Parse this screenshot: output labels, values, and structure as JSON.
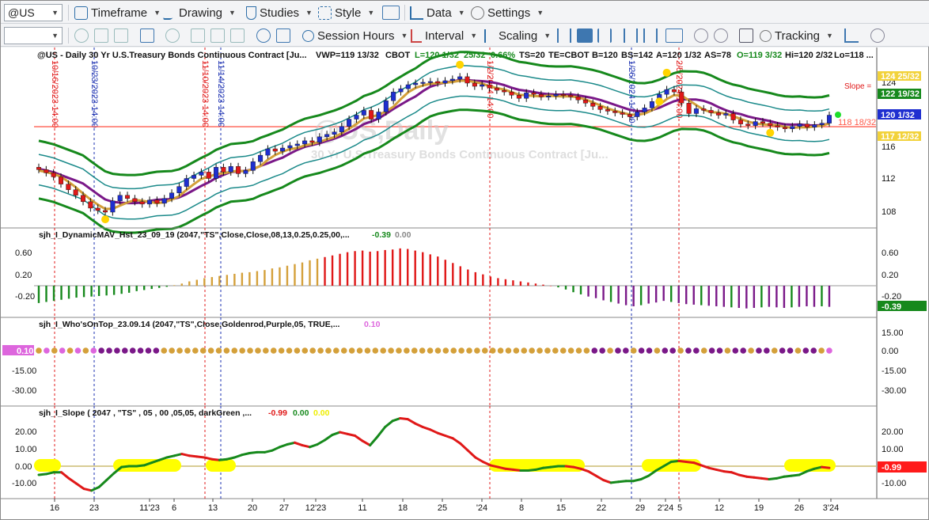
{
  "toolbar1": {
    "symbol": "@US",
    "timeframe": "Timeframe",
    "drawing": "Drawing",
    "studies": "Studies",
    "style": "Style",
    "data": "Data",
    "settings": "Settings"
  },
  "toolbar2": {
    "session_hours": "Session Hours",
    "interval": "Interval",
    "scaling": "Scaling",
    "tracking": "Tracking"
  },
  "colors": {
    "up": "#1f2fd0",
    "down": "#e01818",
    "green": "#16891c",
    "teal": "#1b8a8a",
    "purple": "#7a1888",
    "gold": "#d4a03a",
    "red_line": "#ff3a2a",
    "yellow": "#ffff00"
  },
  "header": {
    "symbol_line": "@US - Daily  30 Yr U.S.Treasury Bonds Continuous Contract [Ju...",
    "vwp": "VWP=119 13/32",
    "exchange": "CBOT",
    "L": "L=120 1/32",
    "chg": "25/32",
    "pct": "0.66%",
    "ts": "TS=20",
    "te": "TE=CBOT",
    "b": "B=120",
    "bs": "BS=142",
    "a": "A=120 1/32",
    "as": "AS=78",
    "o": "O=119 3/32",
    "hi": "Hi=120 2/32",
    "lo": "Lo=118 ..."
  },
  "watermark": {
    "title": "@US,Daily",
    "subtitle": "30 Yr U.S.Treasury Bonds Continuous Contract [Ju..."
  },
  "price_labels": {
    "slope": "Slope =",
    "p1": "124 25/32",
    "p2": "122 19/32",
    "p3": "120 1/32",
    "p4": "118 18/32",
    "p5": "117 12/32"
  },
  "price_axis": [
    "124",
    "120",
    "116",
    "112",
    "108"
  ],
  "vlines": [
    {
      "text": "10/16/2023 14:00",
      "color": "#e01818"
    },
    {
      "text": "10/23/2023 14:00",
      "color": "#1a2fb0"
    },
    {
      "text": "11/10/2023 14:00",
      "color": "#e01818"
    },
    {
      "text": "11/14/2023 14:00",
      "color": "#1a2fb0"
    },
    {
      "text": "1/2/2024 14:00",
      "color": "#e01818"
    },
    {
      "text": "1/26/2024 14:00",
      "color": "#1a2fb0"
    },
    {
      "text": "2/5/2024 14:00",
      "color": "#e01818"
    }
  ],
  "panel2": {
    "label": "sjh_I_DynamicMAV_Hst_23_09_19 (2047,\"TS\",Close,Close,08,13,0.25,0.25,00,...",
    "v1": "-0.39",
    "v2": "0.00",
    "axis": [
      "0.60",
      "0.20",
      "-0.20"
    ],
    "badge": "-0.39"
  },
  "panel3": {
    "label": "sjh_I_Who'sOnTop_23.09.14 (2047,\"TS\",Close,Goldenrod,Purple,05,  TRUE,...",
    "v1": "0.10",
    "axis": [
      "15.00",
      "0.00",
      "-15.00",
      "-30.00"
    ],
    "badge": "0.10"
  },
  "panel4": {
    "label": "sjh_I_Slope ( 2047 , \"TS\" , 05 , 00 ,05,05, darkGreen ,...",
    "v1": "-0.99",
    "v2": "0.00",
    "v3": "0.00",
    "axis": [
      "20.00",
      "10.00",
      "0.00",
      "-10.00"
    ],
    "badge": "-0.99"
  },
  "date_axis": [
    "16",
    "23",
    "11'23",
    "6",
    "13",
    "20",
    "27",
    "12'23",
    "11",
    "18",
    "25",
    "'24",
    "8",
    "15",
    "22",
    "29",
    "2'24",
    "5",
    "12",
    "19",
    "26",
    "3'24"
  ],
  "chart_data": [
    {
      "type": "candlestick",
      "title": "@US - Daily",
      "ylim": [
        106,
        126.5
      ],
      "close": [
        113.2,
        112.8,
        112.3,
        111.4,
        110.7,
        110.0,
        109.2,
        108.4,
        108.1,
        107.9,
        109.3,
        110.0,
        109.6,
        109.2,
        108.9,
        109.4,
        109.0,
        109.6,
        110.3,
        111.1,
        112.1,
        112.5,
        112.9,
        112.1,
        113.5,
        112.9,
        113.6,
        112.7,
        113.1,
        114.2,
        115.0,
        115.8,
        115.5,
        115.9,
        116.2,
        116.4,
        116.8,
        116.6,
        117.3,
        117.6,
        117.9,
        118.6,
        119.5,
        120.0,
        120.6,
        119.5,
        120.4,
        121.8,
        122.9,
        123.3,
        123.8,
        124.0,
        124.1,
        124.2,
        124.0,
        124.3,
        124.5,
        124.8,
        124.0,
        123.6,
        123.8,
        123.4,
        123.1,
        122.9,
        122.5,
        122.1,
        122.8,
        122.6,
        122.3,
        122.4,
        122.6,
        122.5,
        122.3,
        121.9,
        121.5,
        121.1,
        120.7,
        120.5,
        120.3,
        120.1,
        119.8,
        120.4,
        120.9,
        121.7,
        122.6,
        123.2,
        122.9,
        121.5,
        120.2,
        120.8,
        120.6,
        120.3,
        120.0,
        120.2,
        119.4,
        118.9,
        118.7,
        119.2,
        119.0,
        118.7,
        118.5,
        118.3,
        118.6,
        118.9,
        118.5,
        118.8,
        119.0,
        120.0
      ]
    },
    {
      "type": "bar",
      "title": "sjh_I_DynamicMAV_Hst_23_09_19",
      "values": [
        -0.32,
        -0.3,
        -0.28,
        -0.26,
        -0.24,
        -0.22,
        -0.21,
        -0.2,
        -0.19,
        -0.18,
        -0.17,
        -0.15,
        -0.13,
        -0.1,
        -0.08,
        -0.06,
        -0.04,
        -0.02,
        0.01,
        0.04,
        0.08,
        0.11,
        0.14,
        0.16,
        0.18,
        0.2,
        0.22,
        0.24,
        0.25,
        0.27,
        0.29,
        0.32,
        0.34,
        0.37,
        0.4,
        0.43,
        0.47,
        0.5,
        0.53,
        0.56,
        0.59,
        0.62,
        0.64,
        0.65,
        0.63,
        0.64,
        0.66,
        0.67,
        0.69,
        0.68,
        0.65,
        0.62,
        0.58,
        0.54,
        0.48,
        0.42,
        0.36,
        0.3,
        0.25,
        0.21,
        0.17,
        0.14,
        0.12,
        0.1,
        0.08,
        0.06,
        0.04,
        0.02,
        0.0,
        -0.03,
        -0.07,
        -0.12,
        -0.16,
        -0.2,
        -0.23,
        -0.27,
        -0.3,
        -0.33,
        -0.36,
        -0.38,
        -0.36,
        -0.33,
        -0.31,
        -0.28,
        -0.3,
        -0.32,
        -0.34,
        -0.35,
        -0.36,
        -0.37,
        -0.38,
        -0.39,
        -0.4,
        -0.41,
        -0.42,
        -0.41,
        -0.4,
        -0.39,
        -0.4,
        -0.41,
        -0.4,
        -0.39,
        -0.38,
        -0.39,
        -0.38,
        -0.39
      ]
    },
    {
      "type": "scatter",
      "title": "sjh_I_Who'sOnTop_23.09.14",
      "y": 0,
      "state": "purple 0-18, goldenrod 19-81, purple 82-105, pink last"
    },
    {
      "type": "line",
      "title": "sjh_I_Slope",
      "ylim": [
        -15,
        30
      ],
      "values": [
        -5,
        -4.5,
        -3.5,
        -3.5,
        -7,
        -10,
        -13,
        -14,
        -12,
        -8,
        -4,
        -0.5,
        0,
        0,
        0.5,
        2,
        3.5,
        5,
        6,
        7,
        6,
        5.5,
        5,
        4,
        3.5,
        4,
        5,
        6.5,
        7.5,
        8,
        8,
        9,
        11,
        12.5,
        13.5,
        12,
        11,
        12.5,
        15,
        18,
        19.5,
        18.5,
        17.5,
        14.5,
        12,
        17,
        22.5,
        26,
        27.5,
        27,
        24.5,
        22.5,
        21,
        19,
        17.5,
        16,
        13,
        9,
        5,
        2.5,
        0.5,
        -0.5,
        -1.5,
        -2,
        -2.5,
        -2.5,
        -2,
        -1,
        -0.5,
        0,
        0,
        -0.5,
        -1.5,
        -3,
        -5.5,
        -8,
        -9.5,
        -9,
        -8.5,
        -8.5,
        -7.5,
        -5.5,
        -2.5,
        0,
        2.5,
        3,
        2.5,
        2,
        0.5,
        -1,
        -2,
        -3,
        -3.5,
        -5,
        -6,
        -6.5,
        -7,
        -7.5,
        -7,
        -6,
        -5.5,
        -5,
        -3,
        -1.5,
        -0.5,
        -0.99
      ]
    }
  ]
}
